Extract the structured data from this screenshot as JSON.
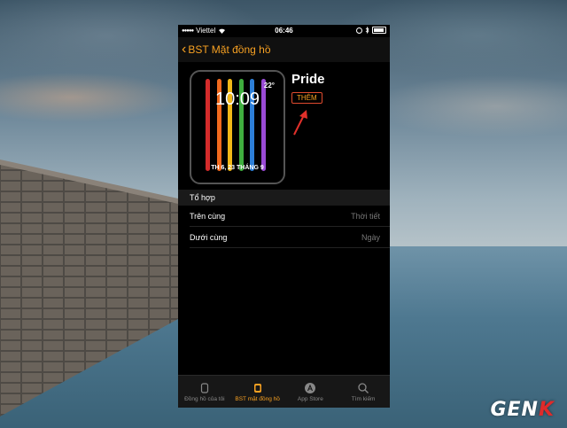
{
  "status_bar": {
    "carrier": "Viettel",
    "time": "06:46"
  },
  "nav": {
    "back_label": "BST Mặt đồng hồ"
  },
  "watch_face": {
    "temperature": "22°",
    "time": "10:09",
    "date": "TH 6, 23 THÁNG 9",
    "stripe_colors": [
      "#d42b2b",
      "#f06a1e",
      "#f2b818",
      "#3fae3f",
      "#2d7fd8",
      "#9a4bd6"
    ]
  },
  "face_name": "Pride",
  "add_label": "THÊM",
  "section": {
    "header": "Tổ hợp",
    "rows": [
      {
        "label": "Trên cùng",
        "value": "Thời tiết"
      },
      {
        "label": "Dưới cùng",
        "value": "Ngày"
      }
    ]
  },
  "tabs": [
    {
      "label": "Đồng hồ của tôi",
      "icon": "watch-icon",
      "active": false
    },
    {
      "label": "BST mặt đồng hồ",
      "icon": "watch-face-gallery-icon",
      "active": true
    },
    {
      "label": "App Store",
      "icon": "app-store-icon",
      "active": false
    },
    {
      "label": "Tìm kiếm",
      "icon": "search-icon",
      "active": false
    }
  ],
  "colors": {
    "accent": "#f7a122",
    "annotation_red": "#e0302a"
  },
  "watermark": "GENK"
}
